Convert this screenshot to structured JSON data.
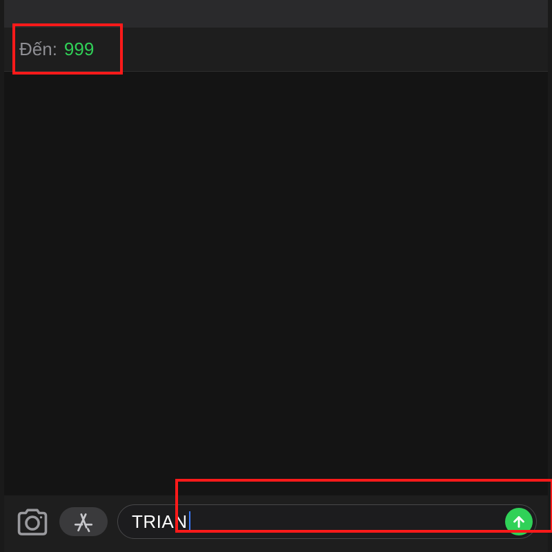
{
  "header": {
    "to_label": "Đến:",
    "to_value": "999"
  },
  "compose": {
    "input_value": "TRIAN"
  },
  "colors": {
    "accent_green": "#30d158",
    "highlight_red": "#ff1a1a"
  }
}
